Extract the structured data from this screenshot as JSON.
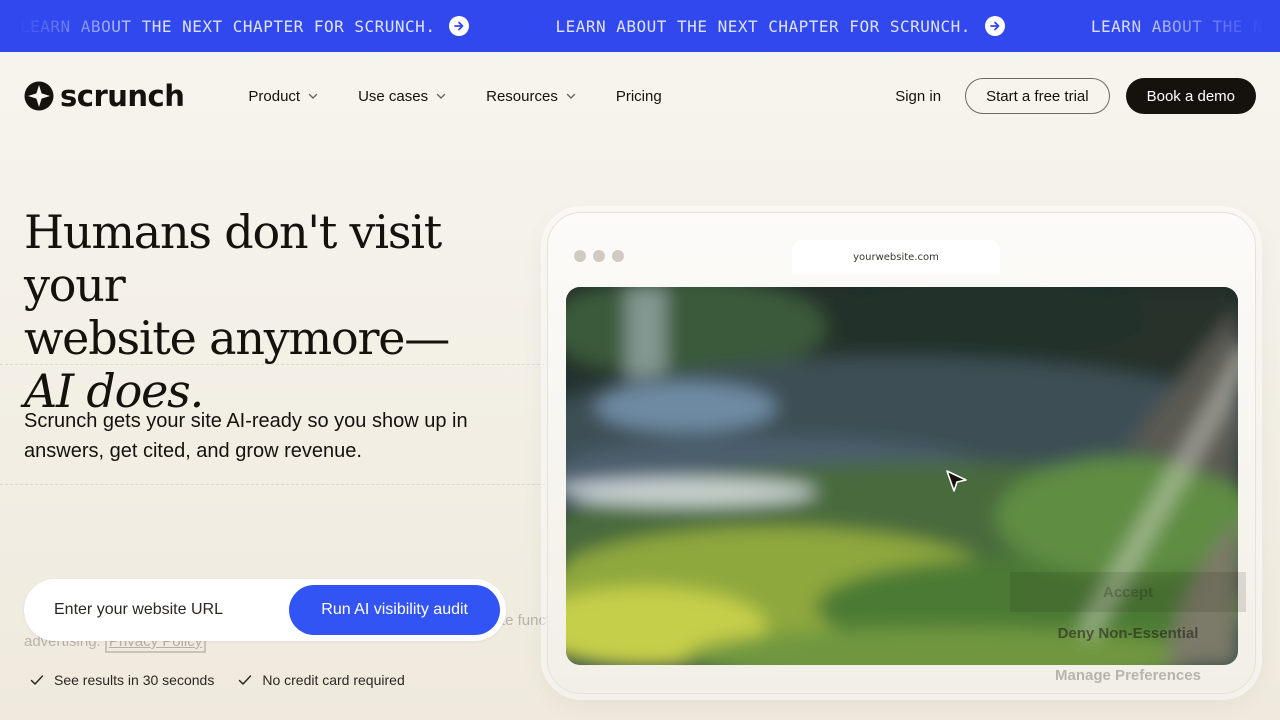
{
  "banner": {
    "message": "LEARN ABOUT THE NEXT CHAPTER FOR SCRUNCH."
  },
  "nav": {
    "logo_text": "scrunch",
    "menu": [
      {
        "label": "Product",
        "has_dropdown": true
      },
      {
        "label": "Use cases",
        "has_dropdown": true
      },
      {
        "label": "Resources",
        "has_dropdown": true
      },
      {
        "label": "Pricing",
        "has_dropdown": false
      }
    ],
    "sign_in": "Sign in",
    "trial_button": "Start a free trial",
    "demo_button": "Book a demo"
  },
  "hero": {
    "title_line1": "Humans don't visit your",
    "title_line2": "website anymore—",
    "title_line3": "AI does.",
    "subtitle": "Scrunch gets your site AI-ready so you show up in answers, get cited, and grow revenue."
  },
  "form": {
    "placeholder": "Enter your website URL",
    "submit_label": "Run AI visibility audit"
  },
  "perks": [
    "See results in 30 seconds",
    "No credit card required"
  ],
  "mockup": {
    "address": "yourwebsite.com"
  },
  "cookie": {
    "text": "This website utilizes technologies such as cookies to enable essential site functionality, as well as for analytics, personalization, and targeted advertising.",
    "link": "Privacy Policy",
    "accept": "Accept",
    "deny": "Deny Non-Essential",
    "manage": "Manage Preferences"
  },
  "colors": {
    "banner": "#3148ee",
    "accent": "#3354f5",
    "dark": "#15120e",
    "background": "#f4f1e9"
  }
}
